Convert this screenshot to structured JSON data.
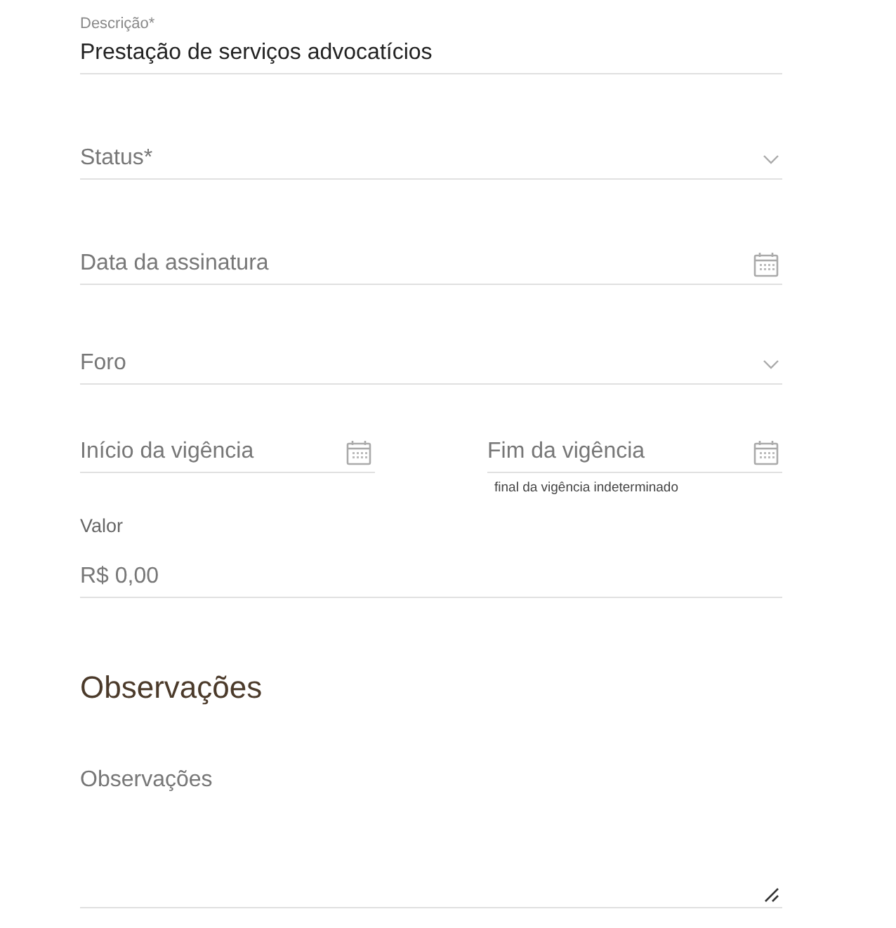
{
  "fields": [
    {
      "kind": "text",
      "label": "Descrição*",
      "value": "Prestação de serviços advocatícios"
    },
    {
      "kind": "select",
      "placeholder": "Status*"
    },
    {
      "kind": "date",
      "placeholder": "Data da assinatura"
    },
    {
      "kind": "select",
      "placeholder": "Foro"
    },
    {
      "kind": "date-pair",
      "items": [
        {
          "placeholder": "Início da vigência"
        },
        {
          "placeholder": "Fim da vigência",
          "hint": "final da vigência indeterminado"
        }
      ]
    },
    {
      "kind": "money",
      "label": "Valor",
      "placeholder": "R$ 0,00"
    }
  ],
  "section": {
    "title": "Observações",
    "textarea": {
      "placeholder": "Observações"
    }
  }
}
